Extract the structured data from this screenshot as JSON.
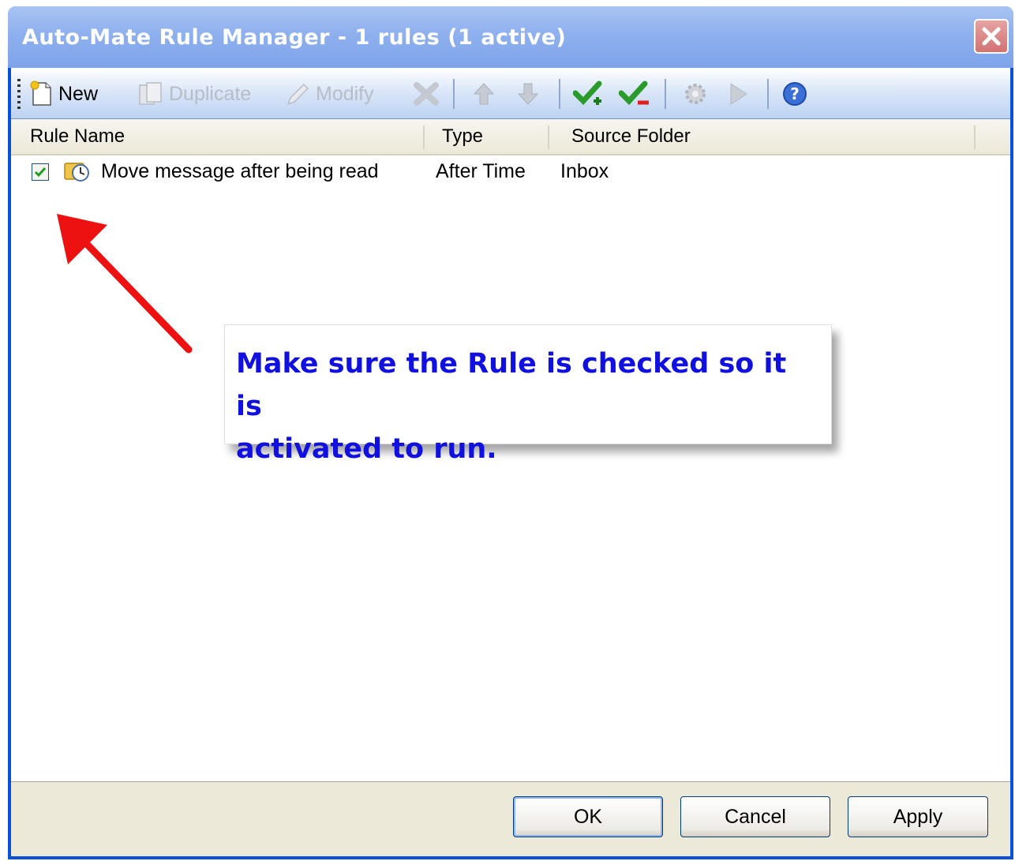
{
  "window": {
    "title": "Auto-Mate Rule Manager - 1 rules (1 active)"
  },
  "toolbar": {
    "new_label": "New",
    "duplicate_label": "Duplicate",
    "modify_label": "Modify",
    "icons": [
      "new-icon",
      "duplicate-icon",
      "modify-icon",
      "delete-icon",
      "move-up-icon",
      "move-down-icon",
      "enable-all-icon",
      "disable-all-icon",
      "settings-icon",
      "run-icon",
      "help-icon"
    ]
  },
  "list": {
    "columns": [
      "Rule Name",
      "Type",
      "Source Folder"
    ],
    "rows": [
      {
        "checked": true,
        "name": "Move message after being read",
        "type": "After Time",
        "source": "Inbox"
      }
    ]
  },
  "callout": {
    "line1": "Make sure the Rule is checked so it is",
    "line2": "activated to run."
  },
  "buttons": {
    "ok": "OK",
    "cancel": "Cancel",
    "apply": "Apply"
  },
  "colors": {
    "title_bar": "#8eb0ee",
    "window_border": "#0a4fd8",
    "callout_text": "#1010e0",
    "arrow": "#ee1111",
    "check": "#1e9e1e"
  }
}
